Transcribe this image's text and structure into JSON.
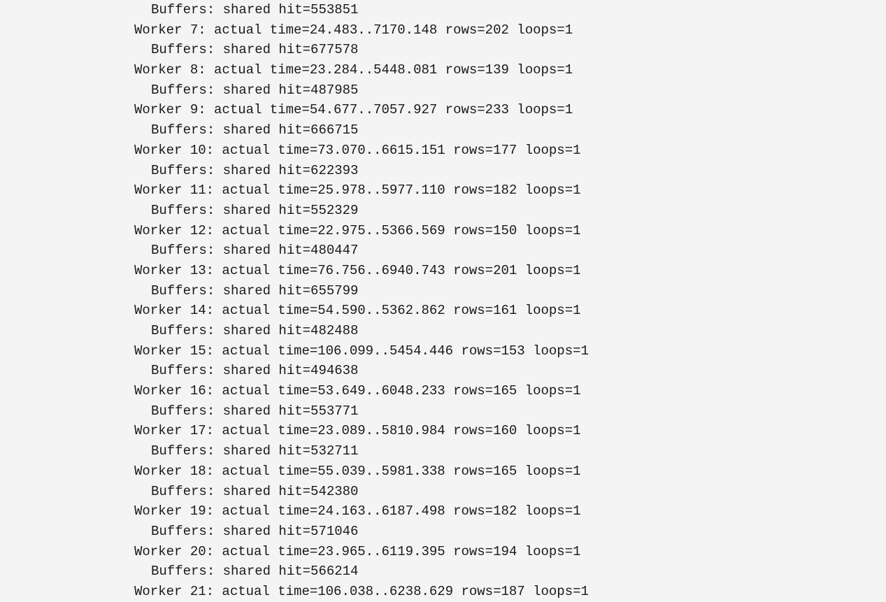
{
  "lines": [
    {
      "type": "buffers",
      "text": "Buffers: shared hit=553851"
    },
    {
      "type": "worker",
      "text": "Worker 7: actual time=24.483..7170.148 rows=202 loops=1"
    },
    {
      "type": "buffers",
      "text": "Buffers: shared hit=677578"
    },
    {
      "type": "worker",
      "text": "Worker 8: actual time=23.284..5448.081 rows=139 loops=1"
    },
    {
      "type": "buffers",
      "text": "Buffers: shared hit=487985"
    },
    {
      "type": "worker",
      "text": "Worker 9: actual time=54.677..7057.927 rows=233 loops=1"
    },
    {
      "type": "buffers",
      "text": "Buffers: shared hit=666715"
    },
    {
      "type": "worker",
      "text": "Worker 10: actual time=73.070..6615.151 rows=177 loops=1"
    },
    {
      "type": "buffers",
      "text": "Buffers: shared hit=622393"
    },
    {
      "type": "worker",
      "text": "Worker 11: actual time=25.978..5977.110 rows=182 loops=1"
    },
    {
      "type": "buffers",
      "text": "Buffers: shared hit=552329"
    },
    {
      "type": "worker",
      "text": "Worker 12: actual time=22.975..5366.569 rows=150 loops=1"
    },
    {
      "type": "buffers",
      "text": "Buffers: shared hit=480447"
    },
    {
      "type": "worker",
      "text": "Worker 13: actual time=76.756..6940.743 rows=201 loops=1"
    },
    {
      "type": "buffers",
      "text": "Buffers: shared hit=655799"
    },
    {
      "type": "worker",
      "text": "Worker 14: actual time=54.590..5362.862 rows=161 loops=1"
    },
    {
      "type": "buffers",
      "text": "Buffers: shared hit=482488"
    },
    {
      "type": "worker",
      "text": "Worker 15: actual time=106.099..5454.446 rows=153 loops=1"
    },
    {
      "type": "buffers",
      "text": "Buffers: shared hit=494638"
    },
    {
      "type": "worker",
      "text": "Worker 16: actual time=53.649..6048.233 rows=165 loops=1"
    },
    {
      "type": "buffers",
      "text": "Buffers: shared hit=553771"
    },
    {
      "type": "worker",
      "text": "Worker 17: actual time=23.089..5810.984 rows=160 loops=1"
    },
    {
      "type": "buffers",
      "text": "Buffers: shared hit=532711"
    },
    {
      "type": "worker",
      "text": "Worker 18: actual time=55.039..5981.338 rows=165 loops=1"
    },
    {
      "type": "buffers",
      "text": "Buffers: shared hit=542380"
    },
    {
      "type": "worker",
      "text": "Worker 19: actual time=24.163..6187.498 rows=182 loops=1"
    },
    {
      "type": "buffers",
      "text": "Buffers: shared hit=571046"
    },
    {
      "type": "worker",
      "text": "Worker 20: actual time=23.965..6119.395 rows=194 loops=1"
    },
    {
      "type": "buffers",
      "text": "Buffers: shared hit=566214"
    },
    {
      "type": "worker",
      "text": "Worker 21: actual time=106.038..6238.629 rows=187 loops=1"
    }
  ]
}
